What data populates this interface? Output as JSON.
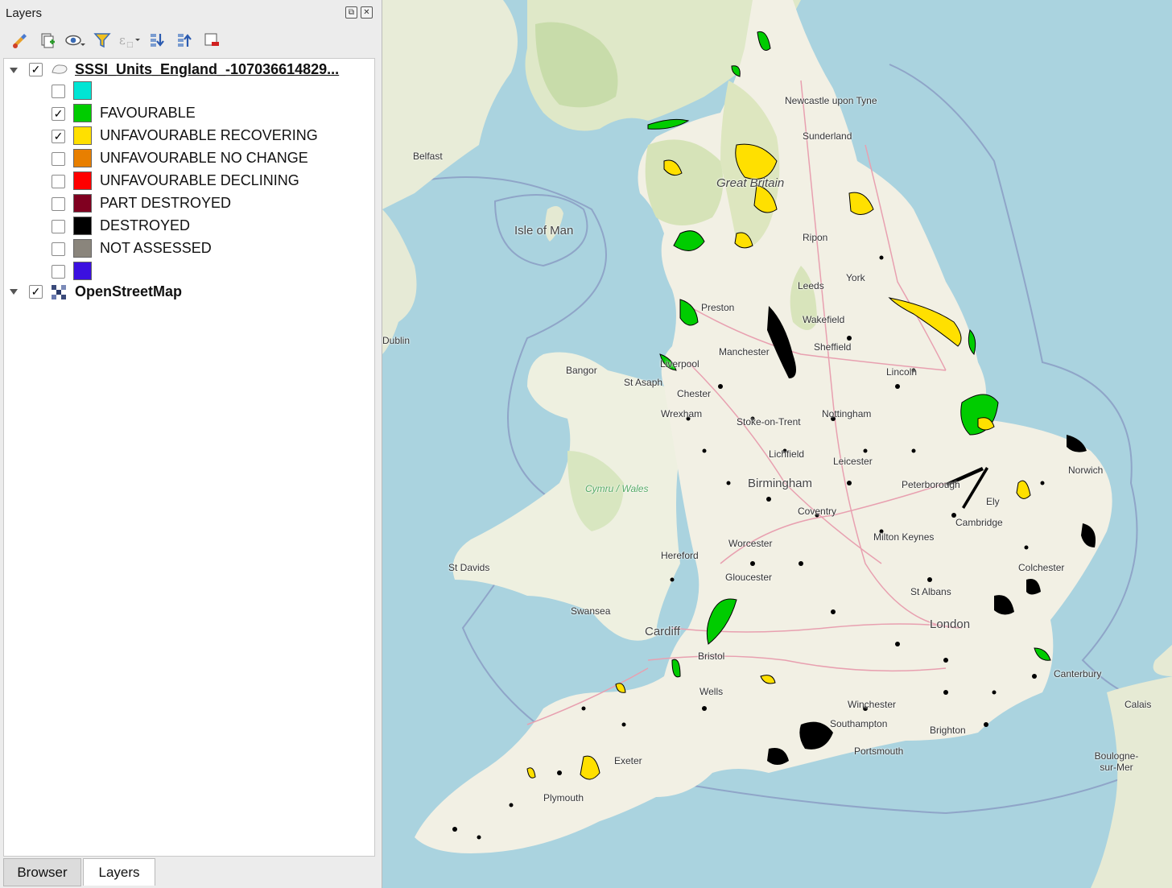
{
  "panel": {
    "title": "Layers",
    "float_icon": "float-icon",
    "close_icon": "close-icon"
  },
  "toolbar": [
    {
      "icon": "style-paint-icon"
    },
    {
      "icon": "add-group-icon"
    },
    {
      "icon": "visibility-eye-icon"
    },
    {
      "icon": "filter-funnel-icon"
    },
    {
      "icon": "expression-filter-icon"
    },
    {
      "icon": "expand-all-icon"
    },
    {
      "icon": "collapse-all-icon"
    },
    {
      "icon": "remove-layer-icon"
    }
  ],
  "layers": [
    {
      "name": "SSSI_Units_England_-107036614829...",
      "checked": true,
      "icon": "polygon-layer-icon",
      "legend": [
        {
          "label": "",
          "color": "#00e5d4",
          "checked": false
        },
        {
          "label": "FAVOURABLE",
          "color": "#00cc00",
          "checked": true
        },
        {
          "label": "UNFAVOURABLE RECOVERING",
          "color": "#ffe000",
          "checked": true
        },
        {
          "label": "UNFAVOURABLE NO CHANGE",
          "color": "#e87f00",
          "checked": false
        },
        {
          "label": "UNFAVOURABLE DECLINING",
          "color": "#ff0000",
          "checked": false
        },
        {
          "label": "PART DESTROYED",
          "color": "#800020",
          "checked": false
        },
        {
          "label": "DESTROYED",
          "color": "#000000",
          "checked": false
        },
        {
          "label": "NOT ASSESSED",
          "color": "#8a857c",
          "checked": false
        },
        {
          "label": "",
          "color": "#3b10e0",
          "checked": false
        }
      ]
    },
    {
      "name": "OpenStreetMap",
      "checked": true,
      "icon": "raster-layer-icon"
    }
  ],
  "tabs": [
    {
      "label": "Browser",
      "active": false
    },
    {
      "label": "Layers",
      "active": true
    }
  ],
  "map": {
    "places": [
      "Newcastle upon Tyne",
      "Sunderland",
      "Belfast",
      "Isle of Man",
      "Great Britain",
      "Ripon",
      "Leeds",
      "York",
      "Preston",
      "Wakefield",
      "Manchester",
      "Sheffield",
      "Liverpool",
      "Bangor",
      "St Asaph",
      "Chester",
      "Wrexham",
      "Lincoln",
      "Stoke-on-Trent",
      "Nottingham",
      "Lichfield",
      "Leicester",
      "Birmingham",
      "Peterborough",
      "Norwich",
      "Coventry",
      "Ely",
      "Cambridge",
      "Cymru / Wales",
      "Hereford",
      "Worcester",
      "Milton Keynes",
      "St Davids",
      "Gloucester",
      "Colchester",
      "St Albans",
      "Swansea",
      "Cardiff",
      "London",
      "Bristol",
      "Canterbury",
      "Wells",
      "Winchester",
      "Calais",
      "Exeter",
      "Southampton",
      "Portsmouth",
      "Brighton",
      "Boulogne-sur-Mer",
      "Plymouth",
      "Dublin"
    ]
  }
}
